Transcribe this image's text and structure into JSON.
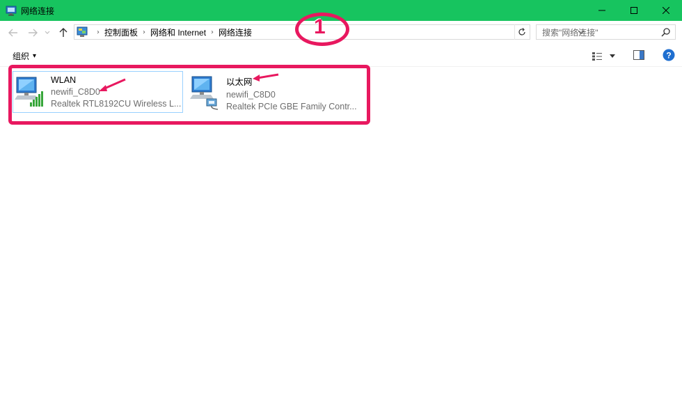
{
  "window": {
    "title": "网络连接",
    "controls": {
      "minimize": "─",
      "maximize": "☐",
      "close": "✕"
    }
  },
  "address_bar": {
    "breadcrumbs": [
      "控制面板",
      "网络和 Internet",
      "网络连接"
    ],
    "separator": "›"
  },
  "search": {
    "placeholder": "搜索\"网络连接\""
  },
  "command_bar": {
    "organize": "组织",
    "organize_caret": "▾"
  },
  "annotation": {
    "number": "1",
    "color": "#e8185f"
  },
  "connections": [
    {
      "name": "WLAN",
      "network": "newifi_C8D0",
      "adapter": "Realtek RTL8192CU Wireless L...",
      "type": "wireless"
    },
    {
      "name": "以太网",
      "network": "newifi_C8D0",
      "adapter": "Realtek PCIe GBE Family Contr...",
      "type": "ethernet"
    }
  ],
  "colors": {
    "titlebar": "#17c45f",
    "selection_border": "#99d1ff",
    "annotation": "#e8185f"
  }
}
